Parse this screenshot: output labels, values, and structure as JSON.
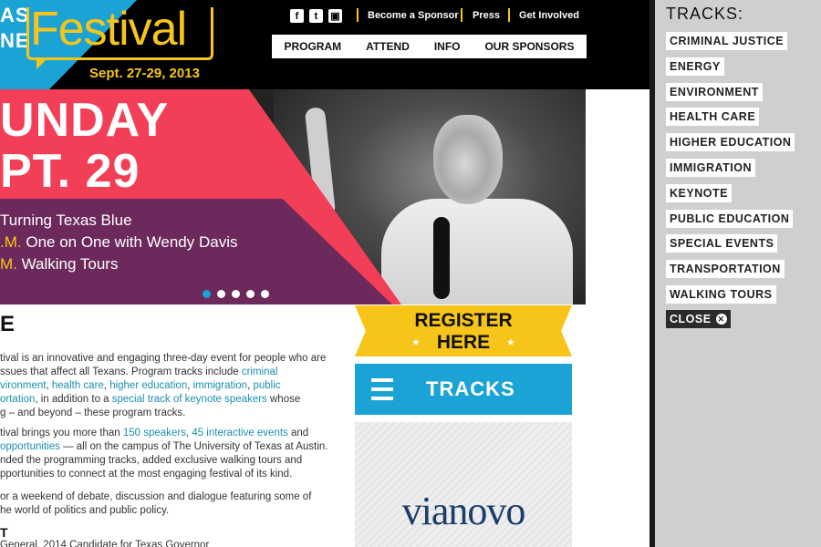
{
  "logo": {
    "word1": "AS",
    "word2": "NE",
    "festival": "Festival",
    "dates": "Sept. 27-29, 2013"
  },
  "social": [
    {
      "icon": "facebook-icon",
      "glyph": "f"
    },
    {
      "icon": "twitter-icon",
      "glyph": "t"
    },
    {
      "icon": "tv-icon",
      "glyph": "▣"
    }
  ],
  "utility_links": [
    "Become a Sponsor",
    "Press",
    "Get Involved"
  ],
  "nav": [
    "PROGRAM",
    "ATTEND",
    "INFO",
    "OUR SPONSORS"
  ],
  "hero": {
    "title_line1": "UNDAY",
    "title_line2": "PT. 29",
    "events": [
      {
        "time": "",
        "label": "Turning Texas Blue"
      },
      {
        "time": ".M.",
        "label": "One on One with Wendy Davis"
      },
      {
        "time": "M.",
        "label": "Walking Tours"
      }
    ],
    "slide_count": 5,
    "active_slide": 1
  },
  "content": {
    "heading": "E",
    "para1": [
      [
        "tival is an innovative and engaging three-day event for people who are",
        ""
      ],
      [
        "ssues that affect all Texans. Program tracks include ",
        "criminal"
      ],
      [
        "vironment, health care, higher education, immigration, public",
        "link"
      ],
      [
        "ortation",
        ", in addition to a ",
        "special track of keynote speakers",
        " whose"
      ],
      [
        "g – and beyond – these program tracks.",
        ""
      ]
    ],
    "p1_l1": "tival is an innovative and engaging three-day event for people who are",
    "p1_l2_a": "ssues that affect all Texans. Program tracks include ",
    "p1_l2_b": "criminal",
    "p1_l3_a": "vironment",
    "p1_l3_b": ", ",
    "p1_l3_c": "health care",
    "p1_l3_d": ", ",
    "p1_l3_e": "higher education",
    "p1_l3_f": ", ",
    "p1_l3_g": "immigration",
    "p1_l3_h": ", ",
    "p1_l3_i": "public",
    "p1_l4_a": "ortation",
    "p1_l4_b": ", in addition to a ",
    "p1_l4_c": "special track of keynote speakers",
    "p1_l4_d": " whose",
    "p1_l5": "g – and beyond – these program tracks.",
    "p2_l1_a": "tival brings you more than ",
    "p2_l1_b": "150 speakers",
    "p2_l1_c": ", ",
    "p2_l1_d": "45 interactive events",
    "p2_l1_e": " and",
    "p2_l2_a": "opportunities",
    "p2_l2_b": " — all on the campus of The University of Texas at Austin.",
    "p2_l3": "nded the programming tracks, added exclusive walking tours and",
    "p2_l4": "pportunities to connect at the most engaging festival of its kind.",
    "p3_l1": "or a weekend of debate, discussion and dialogue featuring some of",
    "p3_l2": "he world of politics and public policy.",
    "heading2": "T",
    "sub_line": "General, 2014 Candidate for Texas Governor"
  },
  "register": {
    "line1": "REGISTER",
    "line2": "HERE",
    "star": "★"
  },
  "tracks_button": {
    "label": "TRACKS"
  },
  "sponsor": {
    "name": "vianovo"
  },
  "panel": {
    "title": "TRACKS:",
    "tracks": [
      "CRIMINAL JUSTICE",
      "ENERGY",
      "ENVIRONMENT",
      "HEALTH CARE",
      "HIGHER EDUCATION",
      "IMMIGRATION",
      "KEYNOTE",
      "PUBLIC EDUCATION",
      "SPECIAL EVENTS",
      "TRANSPORTATION",
      "WALKING TOURS"
    ],
    "close_label": "CLOSE",
    "close_glyph": "✕"
  },
  "colors": {
    "accent_blue": "#1ca3d6",
    "accent_yellow": "#f7c51a",
    "hero_red": "#f23e57",
    "hero_purple": "#6c2a5c",
    "link": "#1b8fb0"
  }
}
